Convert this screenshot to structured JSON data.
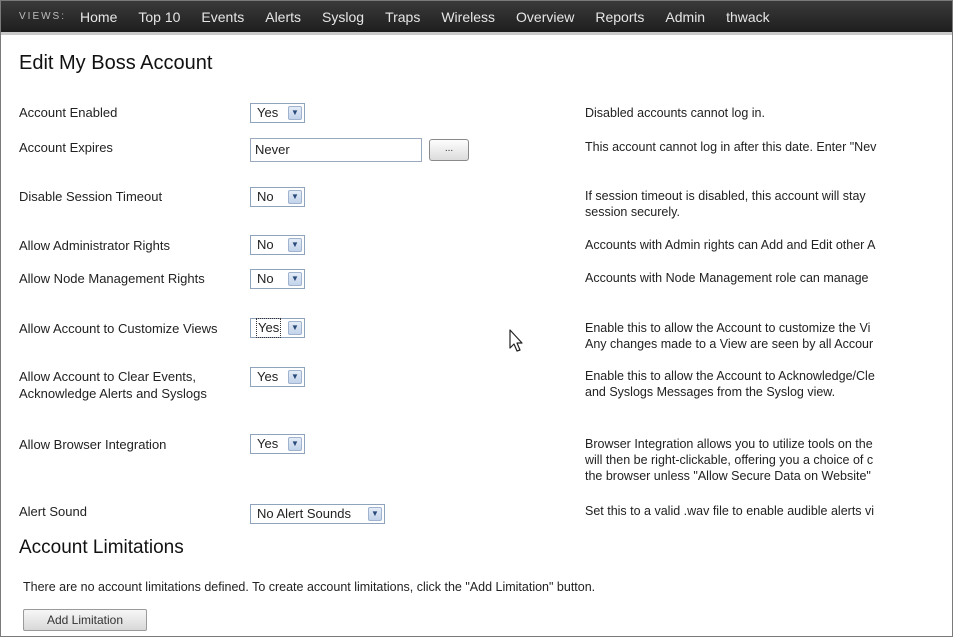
{
  "nav": {
    "views_label": "VIEWS:",
    "items": [
      "Home",
      "Top 10",
      "Events",
      "Alerts",
      "Syslog",
      "Traps",
      "Wireless",
      "Overview",
      "Reports",
      "Admin",
      "thwack"
    ]
  },
  "page_title": "Edit My Boss Account",
  "rows": [
    {
      "label": "Account Enabled",
      "value": "Yes",
      "desc": [
        "Disabled accounts cannot log in."
      ]
    },
    {
      "label": "Account Expires",
      "value": "Never",
      "browse": "...",
      "desc": [
        "This account cannot log in after this date. Enter \"Nev"
      ]
    },
    {
      "label": "Disable Session Timeout",
      "value": "No",
      "desc": [
        "If session timeout is disabled, this account will stay",
        "session securely."
      ]
    },
    {
      "label": "Allow Administrator Rights",
      "value": "No",
      "desc": [
        "Accounts with Admin rights can Add and Edit other A"
      ]
    },
    {
      "label": "Allow Node Management Rights",
      "value": "No",
      "desc": [
        "Accounts with Node Management role can manage"
      ]
    },
    {
      "label": "Allow Account to Customize Views",
      "value": "Yes",
      "desc": [
        "Enable this to allow the Account to customize the Vi",
        "Any changes made to a View are seen by all Accour"
      ]
    },
    {
      "label": "Allow Account to Clear Events, Acknowledge Alerts and Syslogs",
      "value": "Yes",
      "desc": [
        "Enable this to allow the Account to Acknowledge/Cle",
        "and Syslogs Messages from the Syslog view."
      ]
    },
    {
      "label": "Allow Browser Integration",
      "value": "Yes",
      "desc": [
        "Browser Integration allows you to utilize tools on the",
        "will then be right-clickable, offering you a choice of c",
        "the browser unless \"Allow Secure Data on Website\""
      ]
    },
    {
      "label": "Alert Sound",
      "value": "No Alert Sounds",
      "desc": [
        "Set this to a valid .wav file to enable audible alerts vi"
      ]
    }
  ],
  "limitations": {
    "heading": "Account Limitations",
    "note": "There are no account limitations defined. To create account limitations, click the \"Add Limitation\" button.",
    "button": "Add Limitation"
  },
  "icons": {
    "dropdown": "chevron-down-icon",
    "cursor": "mouse-pointer-icon"
  }
}
